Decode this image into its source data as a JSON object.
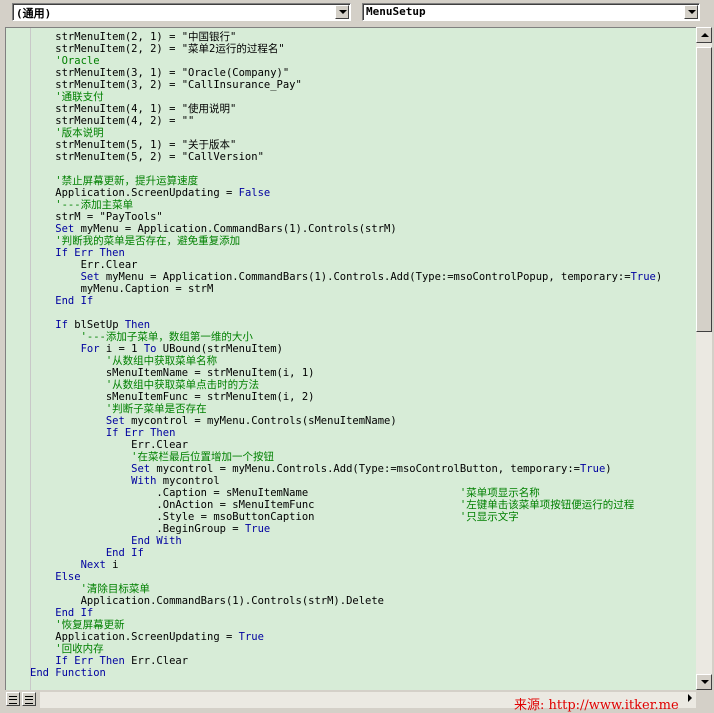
{
  "object_combo": {
    "value": "(通用)"
  },
  "procedure_combo": {
    "value": "MenuSetup"
  },
  "code_lines": [
    [
      [
        "",
        "    strMenuItem(2, 1) = \"中国银行\""
      ]
    ],
    [
      [
        "",
        "    strMenuItem(2, 2) = \"菜单2运行的过程名\""
      ]
    ],
    [
      [
        "cm",
        "    'Oracle"
      ]
    ],
    [
      [
        "",
        "    strMenuItem(3, 1) = \"Oracle(Company)\""
      ]
    ],
    [
      [
        "",
        "    strMenuItem(3, 2) = \"CallInsurance_Pay\""
      ]
    ],
    [
      [
        "cm",
        "    '通联支付"
      ]
    ],
    [
      [
        "",
        "    strMenuItem(4, 1) = \"使用说明\""
      ]
    ],
    [
      [
        "",
        "    strMenuItem(4, 2) = \"\""
      ]
    ],
    [
      [
        "cm",
        "    '版本说明"
      ]
    ],
    [
      [
        "",
        "    strMenuItem(5, 1) = \"关于版本\""
      ]
    ],
    [
      [
        "",
        "    strMenuItem(5, 2) = \"CallVersion\""
      ]
    ],
    [
      [
        "",
        ""
      ]
    ],
    [
      [
        "cm",
        "    '禁止屏幕更新，提升运算速度"
      ]
    ],
    [
      [
        "",
        "    Application.ScreenUpdating = "
      ],
      [
        "kw",
        "False"
      ]
    ],
    [
      [
        "cm",
        "    '---添加主菜单"
      ]
    ],
    [
      [
        "",
        "    strM = \"PayTools\""
      ]
    ],
    [
      [
        "kw",
        "    Set"
      ],
      [
        "",
        " myMenu = Application.CommandBars(1).Controls(strM)"
      ]
    ],
    [
      [
        "cm",
        "    '判断我的菜单是否存在，避免重复添加"
      ]
    ],
    [
      [
        "kw",
        "    If Err Then"
      ]
    ],
    [
      [
        "",
        "        Err.Clear"
      ]
    ],
    [
      [
        "kw",
        "        Set"
      ],
      [
        "",
        " myMenu = Application.CommandBars(1).Controls.Add(Type:=msoControlPopup, temporary:="
      ],
      [
        "kw",
        "True"
      ],
      [
        "",
        ")"
      ]
    ],
    [
      [
        "",
        "        myMenu.Caption = strM"
      ]
    ],
    [
      [
        "kw",
        "    End If"
      ]
    ],
    [
      [
        "",
        ""
      ]
    ],
    [
      [
        "kw",
        "    If"
      ],
      [
        "",
        " blSetUp "
      ],
      [
        "kw",
        "Then"
      ]
    ],
    [
      [
        "cm",
        "        '---添加子菜单，数组第一维的大小"
      ]
    ],
    [
      [
        "kw",
        "        For"
      ],
      [
        "",
        " i = 1 "
      ],
      [
        "kw",
        "To"
      ],
      [
        "",
        " UBound(strMenuItem)"
      ]
    ],
    [
      [
        "cm",
        "            '从数组中获取菜单名称"
      ]
    ],
    [
      [
        "",
        "            sMenuItemName = strMenuItem(i, 1)"
      ]
    ],
    [
      [
        "cm",
        "            '从数组中获取菜单点击时的方法"
      ]
    ],
    [
      [
        "",
        "            sMenuItemFunc = strMenuItem(i, 2)"
      ]
    ],
    [
      [
        "cm",
        "            '判断子菜单是否存在"
      ]
    ],
    [
      [
        "kw",
        "            Set"
      ],
      [
        "",
        " mycontrol = myMenu.Controls(sMenuItemName)"
      ]
    ],
    [
      [
        "kw",
        "            If Err Then"
      ]
    ],
    [
      [
        "",
        "                Err.Clear"
      ]
    ],
    [
      [
        "cm",
        "                '在菜栏最后位置增加一个按钮"
      ]
    ],
    [
      [
        "kw",
        "                Set"
      ],
      [
        "",
        " mycontrol = myMenu.Controls.Add(Type:=msoControlButton, temporary:="
      ],
      [
        "kw",
        "True"
      ],
      [
        "",
        ")"
      ]
    ],
    [
      [
        "kw",
        "                With"
      ],
      [
        "",
        " mycontrol"
      ]
    ],
    [
      [
        "",
        "                    .Caption = sMenuItemName                        "
      ],
      [
        "cm",
        "'菜单项显示名称"
      ]
    ],
    [
      [
        "",
        "                    .OnAction = sMenuItemFunc                       "
      ],
      [
        "cm",
        "'左键单击该菜单项按钮便运行的过程"
      ]
    ],
    [
      [
        "",
        "                    .Style = msoButtonCaption                       "
      ],
      [
        "cm",
        "'只显示文字"
      ]
    ],
    [
      [
        "",
        "                    .BeginGroup = "
      ],
      [
        "kw",
        "True"
      ]
    ],
    [
      [
        "kw",
        "                End With"
      ]
    ],
    [
      [
        "kw",
        "            End If"
      ]
    ],
    [
      [
        "kw",
        "        Next"
      ],
      [
        "",
        " i"
      ]
    ],
    [
      [
        "kw",
        "    Else"
      ]
    ],
    [
      [
        "cm",
        "        '清除目标菜单"
      ]
    ],
    [
      [
        "",
        "        Application.CommandBars(1).Controls(strM).Delete"
      ]
    ],
    [
      [
        "kw",
        "    End If"
      ]
    ],
    [
      [
        "cm",
        "    '恢复屏幕更新"
      ]
    ],
    [
      [
        "",
        "    Application.ScreenUpdating = "
      ],
      [
        "kw",
        "True"
      ]
    ],
    [
      [
        "cm",
        "    '回收内存"
      ]
    ],
    [
      [
        "kw",
        "    If Err Then"
      ],
      [
        "",
        " Err.Clear"
      ]
    ],
    [
      [
        "kw",
        "End Function"
      ]
    ]
  ],
  "watermark": "来源: http://www.itker.me",
  "colors": {
    "editor_bg": "#d7ecd7",
    "keyword": "#0000a0",
    "comment": "#008000",
    "watermark": "#e00000"
  },
  "icons": {
    "object_dropdown": "chevron-down-icon",
    "procedure_dropdown": "chevron-down-icon",
    "scroll_up": "arrow-up-icon",
    "scroll_down": "arrow-down-icon",
    "procedure_view": "procedure-view-icon",
    "full_module_view": "full-module-view-icon"
  }
}
